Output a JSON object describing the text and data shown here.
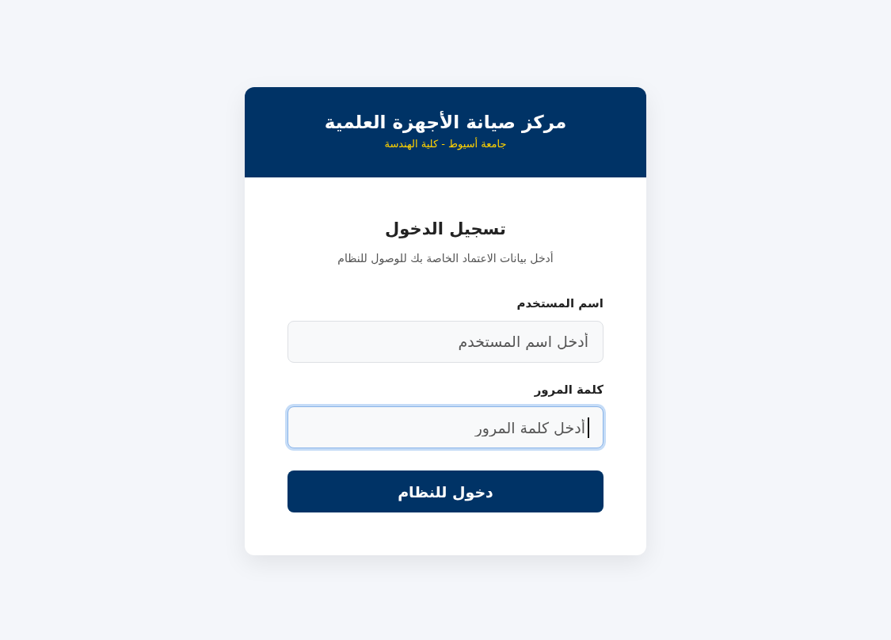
{
  "header": {
    "title": "مركز صيانة الأجهزة العلمية",
    "subtitle": "جامعة أسيوط - كلية الهندسة"
  },
  "login": {
    "heading": "تسجيل الدخول",
    "description": "أدخل بيانات الاعتماد الخاصة بك للوصول للنظام"
  },
  "fields": [
    {
      "label": "اسم المستخدم",
      "placeholder": "أدخل اسم المستخدم",
      "focused": false
    },
    {
      "label": "كلمة المرور",
      "placeholder": "أدخل كلمة المرور",
      "focused": true
    }
  ],
  "submit_button": {
    "label": "دخول للنظام"
  }
}
